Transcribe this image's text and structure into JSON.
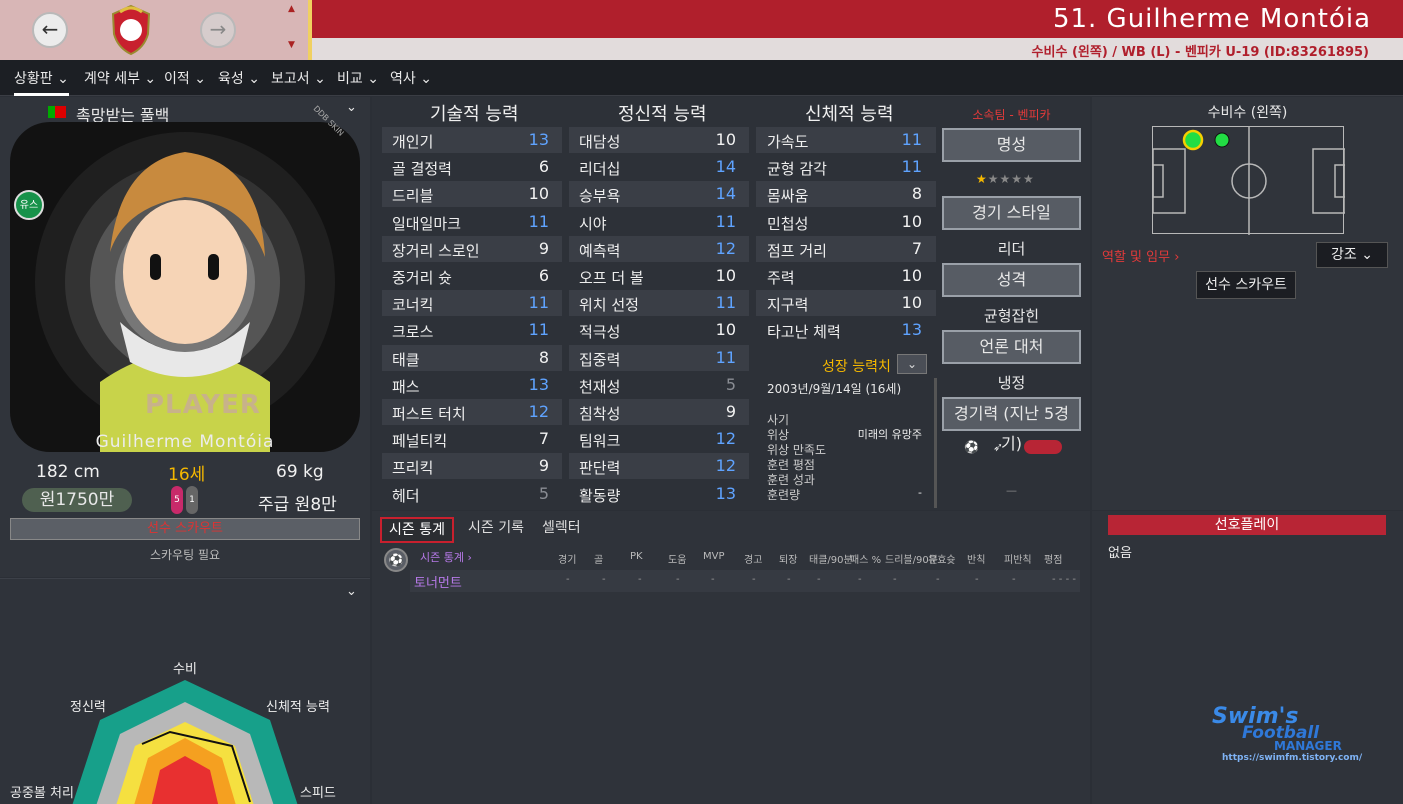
{
  "header": {
    "title": "51. Guilherme Montóia",
    "subtitle": "수비수 (왼쪽) / WB (L) - 벤피카 U-19 (ID:83261895)"
  },
  "menu": [
    "상황판 ⌄",
    "계약 세부 ⌄",
    "이적 ⌄",
    "육성 ⌄",
    "보고서 ⌄",
    "비교 ⌄",
    "역사 ⌄"
  ],
  "player": {
    "tagline": "촉망받는 풀백",
    "youth_badge": "유스",
    "portrait_text": "PLAYER",
    "watermark_text": "DDB SKIN",
    "name": "Guilherme Montóia",
    "height": "182 cm",
    "age": "16세",
    "weight": "69 kg",
    "value": "원1750만",
    "wage": "주급 원8만",
    "left_foot": "5",
    "right_foot": "1",
    "scout_label": "선수 스카우트",
    "scout_note": "스카우팅 필요"
  },
  "attributes": {
    "technical_header": "기술적 능력",
    "mental_header": "정신적 능력",
    "physical_header": "신체적 능력",
    "technical": [
      {
        "name": "개인기",
        "value": "13",
        "tone": "blue"
      },
      {
        "name": "골 결정력",
        "value": "6",
        "tone": "white"
      },
      {
        "name": "드리블",
        "value": "10",
        "tone": "white"
      },
      {
        "name": "일대일마크",
        "value": "11",
        "tone": "blue"
      },
      {
        "name": "장거리 스로인",
        "value": "9",
        "tone": "white"
      },
      {
        "name": "중거리 슛",
        "value": "6",
        "tone": "white"
      },
      {
        "name": "코너킥",
        "value": "11",
        "tone": "blue"
      },
      {
        "name": "크로스",
        "value": "11",
        "tone": "blue"
      },
      {
        "name": "태클",
        "value": "8",
        "tone": "white"
      },
      {
        "name": "패스",
        "value": "13",
        "tone": "blue"
      },
      {
        "name": "퍼스트 터치",
        "value": "12",
        "tone": "blue"
      },
      {
        "name": "페널티킥",
        "value": "7",
        "tone": "white"
      },
      {
        "name": "프리킥",
        "value": "9",
        "tone": "white"
      },
      {
        "name": "헤더",
        "value": "5",
        "tone": "gray"
      }
    ],
    "mental": [
      {
        "name": "대담성",
        "value": "10",
        "tone": "white"
      },
      {
        "name": "리더십",
        "value": "14",
        "tone": "blue"
      },
      {
        "name": "승부욕",
        "value": "14",
        "tone": "blue"
      },
      {
        "name": "시야",
        "value": "11",
        "tone": "blue"
      },
      {
        "name": "예측력",
        "value": "12",
        "tone": "blue"
      },
      {
        "name": "오프 더 볼",
        "value": "10",
        "tone": "white"
      },
      {
        "name": "위치 선정",
        "value": "11",
        "tone": "blue"
      },
      {
        "name": "적극성",
        "value": "10",
        "tone": "white"
      },
      {
        "name": "집중력",
        "value": "11",
        "tone": "blue"
      },
      {
        "name": "천재성",
        "value": "5",
        "tone": "gray"
      },
      {
        "name": "침착성",
        "value": "9",
        "tone": "white"
      },
      {
        "name": "팀워크",
        "value": "12",
        "tone": "blue"
      },
      {
        "name": "판단력",
        "value": "12",
        "tone": "blue"
      },
      {
        "name": "활동량",
        "value": "13",
        "tone": "blue"
      }
    ],
    "physical": [
      {
        "name": "가속도",
        "value": "11",
        "tone": "blue"
      },
      {
        "name": "균형 감각",
        "value": "11",
        "tone": "blue"
      },
      {
        "name": "몸싸움",
        "value": "8",
        "tone": "white"
      },
      {
        "name": "민첩성",
        "value": "10",
        "tone": "white"
      },
      {
        "name": "점프 거리",
        "value": "7",
        "tone": "white"
      },
      {
        "name": "주력",
        "value": "10",
        "tone": "white"
      },
      {
        "name": "지구력",
        "value": "10",
        "tone": "white"
      },
      {
        "name": "타고난 체력",
        "value": "13",
        "tone": "blue"
      }
    ]
  },
  "growth": {
    "title": "성장 능력치",
    "dob": "2003년/9월/14일 (16세)",
    "rows": [
      {
        "label": "사기",
        "value": ""
      },
      {
        "label": "위상",
        "value": "미래의 유망주"
      },
      {
        "label": "위상 만족도",
        "value": ""
      },
      {
        "label": "훈련 평점",
        "value": ""
      },
      {
        "label": "훈련 성과",
        "value": ""
      },
      {
        "label": "훈련량",
        "value": "-"
      }
    ]
  },
  "club_panel": {
    "club": "소속팀 - 벤피카",
    "reputation_btn": "명성",
    "style_btn": "경기 스타일",
    "style_value": "리더",
    "personality_btn": "성격",
    "personality_value": "균형잡힌",
    "media_btn": "언론 대처",
    "media_value": "냉정",
    "form_btn": "경기력 (지난 5경기)",
    "form_value": "—"
  },
  "position_panel": {
    "title": "수비수 (왼쪽)",
    "roles_link": "역할 및 임무 ›",
    "highlight_dd": "강조 ⌄",
    "scout_btn": "선수 스카우트"
  },
  "stats_tabs": [
    "시즌 통계",
    "시즌 기록",
    "셀렉터"
  ],
  "stats_table": {
    "section_link": "시즌 통계 ›",
    "columns": [
      "경기",
      "골",
      "PK",
      "도움",
      "MVP",
      "경고",
      "퇴장",
      "태클/90분",
      "패스 %",
      "드리블/90분",
      "유효슛",
      "반칙",
      "피반칙",
      "평점"
    ],
    "row_label": "토너먼트",
    "row_values": [
      "-",
      "-",
      "-",
      "-",
      "-",
      "-",
      "-",
      "-",
      "-",
      "-",
      "-",
      "-",
      "-",
      "- - - -"
    ]
  },
  "preferred_moves": {
    "title": "선호플레이",
    "value": "없음"
  },
  "radar": {
    "labels": [
      "수비",
      "신체적 능력",
      "스피드",
      "공중볼 처리",
      "정신력"
    ]
  },
  "watermark": {
    "line1": "Swim's",
    "line2": "Football",
    "line3": "MANAGER",
    "url": "https://swimfm.tistory.com/"
  },
  "colors": {
    "header_red": "#b01f2c",
    "accent_blue": "#5fa3ff",
    "positive_green": "#17924a"
  }
}
